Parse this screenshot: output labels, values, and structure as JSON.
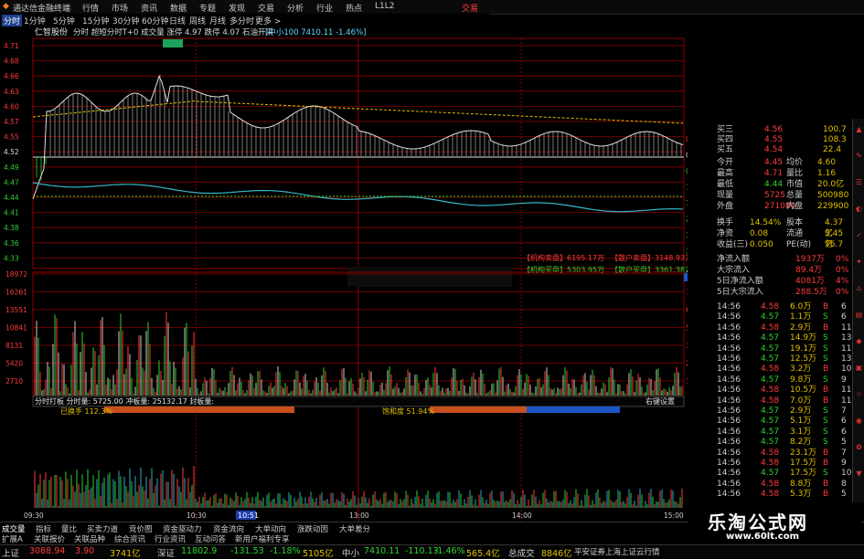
{
  "titlebar": {
    "app_name": "通达信金融终端",
    "menu": [
      "行情",
      "市场",
      "资讯",
      "数据",
      "专题",
      "发现",
      "交易",
      "分析",
      "行业",
      "热点",
      "L1L2"
    ],
    "right": "交易"
  },
  "toolbar": {
    "periods": [
      "分时",
      "1分钟",
      "5分钟",
      "15分钟",
      "30分钟",
      "60分钟",
      "日线",
      "周线",
      "月线",
      "多分时",
      "更多 >"
    ],
    "active": "分时"
  },
  "chart": {
    "stock_name": "仁智股份",
    "header_line": "分时 超短分时T+0 成交量 涨停 4.97 跌停 4.07 石油开采",
    "index_label": "[中小100 7410.11 -1.46%]",
    "price_ticks": [
      "4.71",
      "4.68",
      "4.66",
      "4.63",
      "4.60",
      "4.57",
      "4.55",
      "4.52",
      "4.49",
      "4.47",
      "4.44",
      "4.41",
      "4.38",
      "4.36",
      "4.33"
    ],
    "pct_ticks": [
      "0.60%",
      "0.00%",
      "0.60%",
      "1.20%",
      "1.80%",
      "2.40%",
      "3.00%",
      "3.60%"
    ],
    "vol_ticks": [
      "18972",
      "16261",
      "13551",
      "10841",
      "8131",
      "5420",
      "2710"
    ],
    "vol_right_ticks": [
      "17620",
      "757.0万",
      "631.5万",
      "505.2万",
      "378.9万",
      "252.6万",
      "126.3万"
    ],
    "fund_labels": {
      "inst_sell": "【机构卖盘】6195.17万",
      "retail_sell": "【散户卖盘】3148.93万",
      "inst_buy": "【机构买盘】5303.95万",
      "retail_buy": "【散户买盘】3361.38万"
    },
    "mid_bar": "分时打板 分时量: 5725.00 冲板量: 25132.17 封板量:",
    "mid_bar_right": "右键设置",
    "turnover_label": "已换手 112.3%",
    "saturation_label": "饱和度 51.94%",
    "sub_ticks": [
      "1.9万",
      "1.3万",
      "6283.29"
    ],
    "time_ticks": [
      "09:30",
      "10:30",
      "13:00",
      "14:00",
      "15:00"
    ],
    "cursor_time": "10:51"
  },
  "quote": {
    "levels": [
      {
        "label": "买三",
        "price": "4.56",
        "vol": "100.7"
      },
      {
        "label": "买四",
        "price": "4.55",
        "vol": "108.3"
      },
      {
        "label": "买五",
        "price": "4.54",
        "vol": "22.4"
      }
    ],
    "stats": [
      {
        "l1": "今开",
        "v1": "4.45",
        "l2": "均价",
        "v2": "4.60"
      },
      {
        "l1": "最高",
        "v1": "4.71",
        "l2": "量比",
        "v2": "1.16"
      },
      {
        "l1": "最低",
        "v1": "4.44",
        "l2": "市值",
        "v2": "20.0亿"
      },
      {
        "l1": "现量",
        "v1": "5725",
        "l2": "总量",
        "v2": "500980"
      },
      {
        "l1": "外盘",
        "v1": "271080",
        "l2": "内盘",
        "v2": "229900"
      }
    ],
    "stats2": [
      {
        "l1": "换手",
        "v1": "14.54%",
        "l2": "股本",
        "v2": "4.37亿"
      },
      {
        "l1": "净资",
        "v1": "0.08",
        "l2": "流通",
        "v2": "3.45亿"
      },
      {
        "l1": "收益(三)",
        "v1": "0.050",
        "l2": "PE(动)",
        "v2": "76.7"
      }
    ],
    "flows": [
      {
        "label": "净流入额",
        "value": "1937万",
        "pct": "0%"
      },
      {
        "label": "大宗流入",
        "value": "89.4万",
        "pct": "0%"
      },
      {
        "label": "5日净流入额",
        "value": "4081万",
        "pct": "4%"
      },
      {
        "label": "5日大宗流入",
        "value": "288.5万",
        "pct": "0%"
      }
    ],
    "ticks": [
      {
        "t": "14:56",
        "p": "4.58",
        "v": "6.0万",
        "s": "B",
        "n": "6"
      },
      {
        "t": "14:56",
        "p": "4.57",
        "v": "1.1万",
        "s": "S",
        "n": "6"
      },
      {
        "t": "14:56",
        "p": "4.58",
        "v": "2.9万",
        "s": "B",
        "n": "11"
      },
      {
        "t": "14:56",
        "p": "4.57",
        "v": "14.9万",
        "s": "S",
        "n": "13"
      },
      {
        "t": "14:56",
        "p": "4.57",
        "v": "19.1万",
        "s": "S",
        "n": "11"
      },
      {
        "t": "14:56",
        "p": "4.57",
        "v": "12.5万",
        "s": "S",
        "n": "13"
      },
      {
        "t": "14:56",
        "p": "4.58",
        "v": "3.2万",
        "s": "B",
        "n": "10"
      },
      {
        "t": "14:56",
        "p": "4.57",
        "v": "9.8万",
        "s": "S",
        "n": "9"
      },
      {
        "t": "14:56",
        "p": "4.58",
        "v": "10.5万",
        "s": "B",
        "n": "11"
      },
      {
        "t": "14:56",
        "p": "4.58",
        "v": "7.0万",
        "s": "B",
        "n": "11"
      },
      {
        "t": "14:56",
        "p": "4.57",
        "v": "2.9万",
        "s": "S",
        "n": "7"
      },
      {
        "t": "14:56",
        "p": "4.57",
        "v": "5.1万",
        "s": "S",
        "n": "6"
      },
      {
        "t": "14:56",
        "p": "4.57",
        "v": "3.1万",
        "s": "S",
        "n": "6"
      },
      {
        "t": "14:56",
        "p": "4.57",
        "v": "8.2万",
        "s": "S",
        "n": "5"
      },
      {
        "t": "14:56",
        "p": "4.58",
        "v": "23.1万",
        "s": "B",
        "n": "7"
      },
      {
        "t": "14:56",
        "p": "4.58",
        "v": "17.5万",
        "s": "B",
        "n": "9"
      },
      {
        "t": "14:56",
        "p": "4.57",
        "v": "17.5万",
        "s": "S",
        "n": "10"
      },
      {
        "t": "14:56",
        "p": "4.58",
        "v": "8.8万",
        "s": "B",
        "n": "8"
      },
      {
        "t": "14:56",
        "p": "4.58",
        "v": "5.3万",
        "s": "B",
        "n": "5"
      }
    ]
  },
  "tabs1": [
    "成交量",
    "指标",
    "量比",
    "买卖力道",
    "竞价图",
    "资金驱动力",
    "资金流向",
    "大单动向",
    "涨跌动因",
    "大单差分"
  ],
  "tabs2": [
    "扩展A",
    "关联报价",
    "关联品种",
    "综合资讯",
    "行业资讯",
    "互动问答",
    "新用户福利专享"
  ],
  "tabs_right": "图文 F10",
  "ticker": [
    {
      "label": "上证",
      "value": "3088.94",
      "chg": "3.90",
      "amt": "3741亿"
    },
    {
      "label": "深证",
      "value": "11802.9",
      "chg": "-131.53",
      "pct": "-1.18%",
      "amt": "5105亿"
    },
    {
      "label": "中小",
      "value": "7410.11",
      "chg": "-110.13",
      "pct": "-1.46%",
      "amt": "565.4亿"
    },
    {
      "label": "总成交",
      "value": "8846亿"
    }
  ],
  "ticker_right": "平安证券上海上证云行情",
  "watermark": {
    "title": "乐淘公式网",
    "url": "www.60lt.com"
  },
  "colors": {
    "up": "#ff3b3b",
    "down": "#2cd32c",
    "price_line": "#e0e0e0",
    "avg_line": "#e0c000",
    "grid": "#8b0000",
    "blue": "#1e56c8",
    "orange": "#c8501e"
  }
}
